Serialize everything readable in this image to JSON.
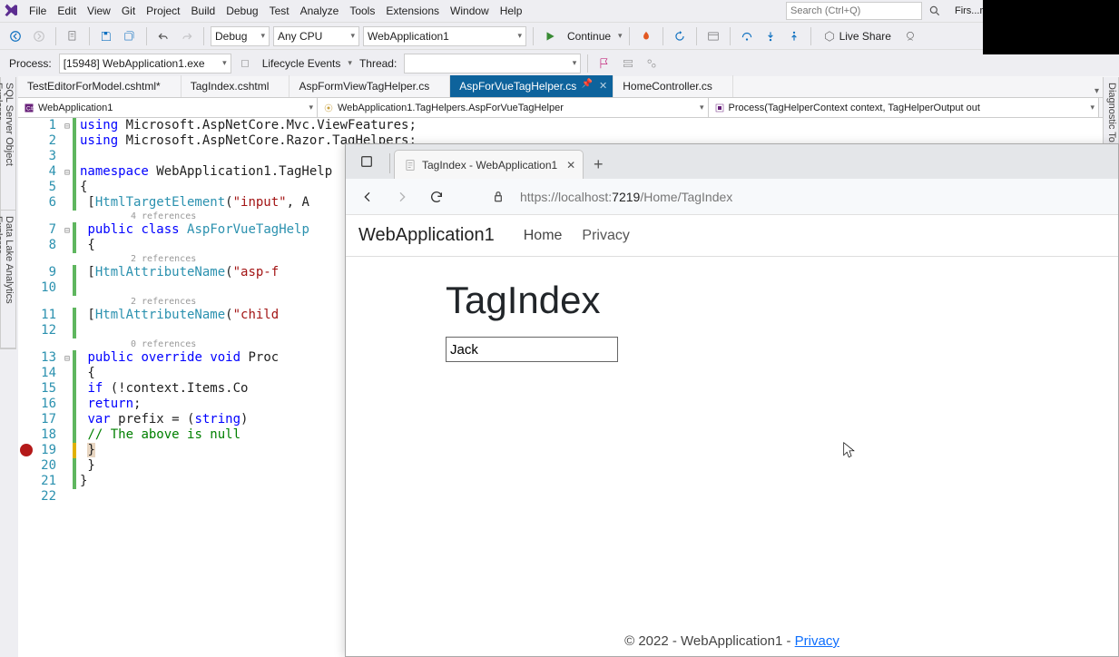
{
  "menu": {
    "items": [
      "File",
      "Edit",
      "View",
      "Git",
      "Project",
      "Build",
      "Debug",
      "Test",
      "Analyze",
      "Tools",
      "Extensions",
      "Window",
      "Help"
    ]
  },
  "search_placeholder": "Search (Ctrl+Q)",
  "solution_name": "Firs...reAPI",
  "toolbar1": {
    "config": "Debug",
    "platform": "Any CPU",
    "target": "WebApplication1",
    "continue": "Continue",
    "live_share": "Live Share"
  },
  "toolbar2": {
    "process_label": "Process:",
    "process_value": "[15948] WebApplication1.exe",
    "lifecycle": "Lifecycle Events",
    "thread": "Thread:"
  },
  "side_left": [
    "SQL Server Object Explorer",
    "Data Lake Analytics Explorer"
  ],
  "side_right": [
    "Diagnostic To..."
  ],
  "tabs": [
    {
      "label": "TestEditorForModel.cshtml*",
      "active": false
    },
    {
      "label": "TagIndex.cshtml",
      "active": false
    },
    {
      "label": "AspFormViewTagHelper.cs",
      "active": false
    },
    {
      "label": "AspForVueTagHelper.cs",
      "active": true
    },
    {
      "label": "HomeController.cs",
      "active": false
    }
  ],
  "context": {
    "project": "WebApplication1",
    "type": "WebApplication1.TagHelpers.AspForVueTagHelper",
    "member": "Process(TagHelperContext context, TagHelperOutput out"
  },
  "code": {
    "lines": [
      {
        "n": 1,
        "glyph": "⊟",
        "green": true,
        "html": "<span class='kw'>using</span> Microsoft.AspNetCore.Mvc.ViewFeatures;"
      },
      {
        "n": 2,
        "glyph": "",
        "green": true,
        "html": "<span class='kw'>using</span> Microsoft.AspNetCore.Razor.TagHelpers;"
      },
      {
        "n": 3,
        "glyph": "",
        "green": true,
        "html": ""
      },
      {
        "n": 4,
        "glyph": "⊟",
        "green": true,
        "html": "<span class='kw'>namespace</span> WebApplication1.TagHelp"
      },
      {
        "n": 5,
        "glyph": "",
        "green": true,
        "html": "{"
      },
      {
        "n": 6,
        "glyph": "",
        "green": true,
        "html": "    [<span class='type'>HtmlTargetElement</span>(<span class='str'>\"input\"</span>, A"
      },
      {
        "lens": "4 references"
      },
      {
        "n": 7,
        "glyph": "⊟",
        "green": true,
        "html": "    <span class='kw'>public</span> <span class='kw'>class</span> <span class='type'>AspForVueTagHelp</span>"
      },
      {
        "n": 8,
        "glyph": "",
        "green": true,
        "html": "    {"
      },
      {
        "lens": "2 references"
      },
      {
        "n": 9,
        "glyph": "",
        "green": true,
        "html": "        [<span class='type'>HtmlAttributeName</span>(<span class='str'>\"asp-f</span>"
      },
      {
        "n": 10,
        "glyph": "",
        "green": true,
        "html": ""
      },
      {
        "lens": "2 references"
      },
      {
        "n": 11,
        "glyph": "",
        "green": true,
        "html": "        [<span class='type'>HtmlAttributeName</span>(<span class='str'>\"child</span>"
      },
      {
        "n": 12,
        "glyph": "",
        "green": true,
        "html": ""
      },
      {
        "lens": "0 references"
      },
      {
        "n": 13,
        "glyph": "⊟",
        "green": true,
        "html": "        <span class='kw'>public</span> <span class='kw'>override</span> <span class='kw'>void</span> Proc"
      },
      {
        "n": 14,
        "glyph": "",
        "green": true,
        "html": "        {"
      },
      {
        "n": 15,
        "glyph": "",
        "green": true,
        "html": "            <span class='kw'>if</span> (!context.Items.Co"
      },
      {
        "n": 16,
        "glyph": "",
        "green": true,
        "html": "                <span class='kw'>return</span>;"
      },
      {
        "n": 17,
        "glyph": "",
        "green": true,
        "html": "            <span class='kw'>var</span> prefix = (<span class='kw'>string</span>)"
      },
      {
        "n": 18,
        "glyph": "",
        "green": true,
        "html": "            <span class='comm'>// The above is null</span>"
      },
      {
        "n": 19,
        "glyph": "",
        "amber": true,
        "bp": true,
        "html": "        <span class='highlight-brace'>}</span>"
      },
      {
        "n": 20,
        "glyph": "",
        "green": true,
        "html": "    }"
      },
      {
        "n": 21,
        "glyph": "",
        "green": true,
        "html": "}"
      },
      {
        "n": 22,
        "glyph": "",
        "html": ""
      }
    ]
  },
  "browser": {
    "tab_title": "TagIndex - WebApplication1",
    "url_host": "https://localhost:",
    "url_port": "7219",
    "url_path": "/Home/TagIndex",
    "brand": "WebApplication1",
    "nav_home": "Home",
    "nav_privacy": "Privacy",
    "h1": "TagIndex",
    "input_value": "Jack",
    "footer_text": "© 2022 - WebApplication1 - ",
    "footer_link": "Privacy"
  }
}
